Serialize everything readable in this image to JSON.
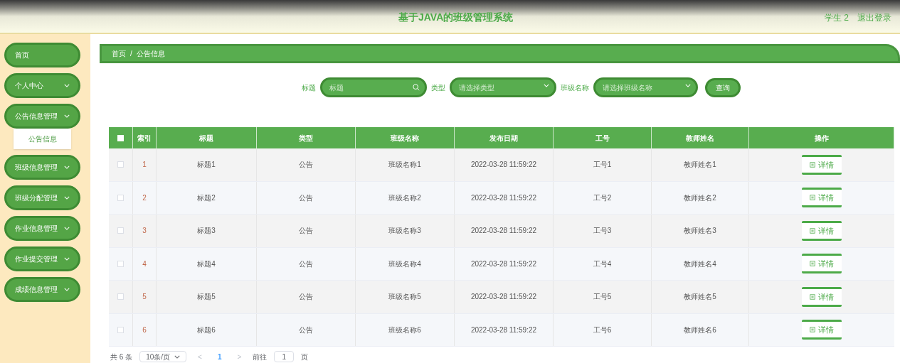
{
  "header": {
    "title": "基于JAVA的班级管理系统",
    "user": "学生 2",
    "logout": "退出登录"
  },
  "sidebar": {
    "items": [
      {
        "label": "首页",
        "expandable": false
      },
      {
        "label": "个人中心",
        "expandable": true
      },
      {
        "label": "公告信息管理",
        "expandable": true,
        "children": [
          {
            "label": "公告信息"
          }
        ]
      },
      {
        "label": "班级信息管理",
        "expandable": true
      },
      {
        "label": "班级分配管理",
        "expandable": true
      },
      {
        "label": "作业信息管理",
        "expandable": true
      },
      {
        "label": "作业提交管理",
        "expandable": true
      },
      {
        "label": "成绩信息管理",
        "expandable": true
      }
    ]
  },
  "breadcrumb": {
    "items": [
      "首页",
      "公告信息"
    ],
    "separator": "/"
  },
  "filters": [
    {
      "kind": "search",
      "label": "标题",
      "placeholder": "标题"
    },
    {
      "kind": "select",
      "label": "类型",
      "placeholder": "请选择类型"
    },
    {
      "kind": "select",
      "label": "班级名称",
      "placeholder": "请选择班级名称"
    }
  ],
  "query_button": "查询",
  "table": {
    "select_all_checked": false,
    "columns": [
      "索引",
      "标题",
      "类型",
      "班级名称",
      "发布日期",
      "工号",
      "教师姓名",
      "操作"
    ],
    "rows": [
      {
        "checked": false,
        "cells": [
          "1",
          "标题1",
          "公告",
          "班级名称1",
          "2022-03-28 11:59:22",
          "工号1",
          "教师姓名1"
        ],
        "action": "详情"
      },
      {
        "checked": false,
        "cells": [
          "2",
          "标题2",
          "公告",
          "班级名称2",
          "2022-03-28 11:59:22",
          "工号2",
          "教师姓名2"
        ],
        "action": "详情"
      },
      {
        "checked": false,
        "cells": [
          "3",
          "标题3",
          "公告",
          "班级名称3",
          "2022-03-28 11:59:22",
          "工号3",
          "教师姓名3"
        ],
        "action": "详情"
      },
      {
        "checked": false,
        "cells": [
          "4",
          "标题4",
          "公告",
          "班级名称4",
          "2022-03-28 11:59:22",
          "工号4",
          "教师姓名4"
        ],
        "action": "详情"
      },
      {
        "checked": false,
        "cells": [
          "5",
          "标题5",
          "公告",
          "班级名称5",
          "2022-03-28 11:59:22",
          "工号5",
          "教师姓名5"
        ],
        "action": "详情"
      },
      {
        "checked": false,
        "cells": [
          "6",
          "标题6",
          "公告",
          "班级名称6",
          "2022-03-28 11:59:22",
          "工号6",
          "教师姓名6"
        ],
        "action": "详情"
      }
    ]
  },
  "pagination": {
    "total": "共 6 条",
    "page_size": "10条/页",
    "prev": "<",
    "pages": [
      {
        "label": "1",
        "selected": true
      }
    ],
    "next": ">",
    "goto_label": "前往",
    "goto_value": "1",
    "goto_suffix": "页"
  }
}
